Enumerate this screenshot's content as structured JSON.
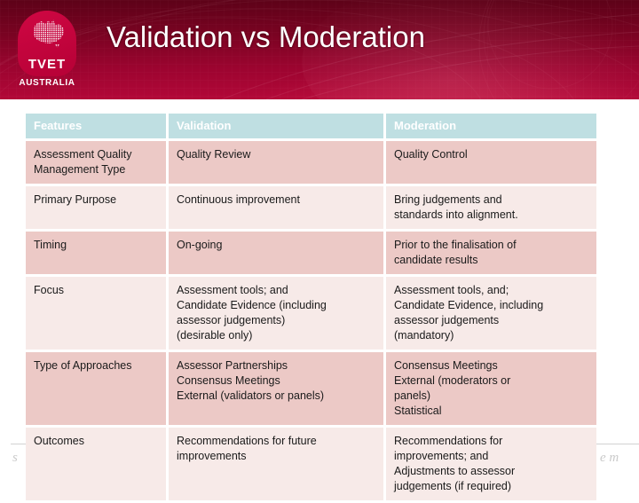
{
  "header": {
    "title": "Validation vs Moderation",
    "logo": {
      "mark_text": "TVET",
      "country_text": "AUSTRALIA"
    }
  },
  "watermarks": {
    "left": "s",
    "right": "e  m"
  },
  "table": {
    "columns": [
      "Features",
      "Validation",
      "Moderation"
    ],
    "rows": [
      {
        "feature": [
          "Assessment Quality",
          "Management Type"
        ],
        "validation": [
          "Quality Review"
        ],
        "moderation": [
          "Quality Control"
        ]
      },
      {
        "feature": [
          "Primary Purpose"
        ],
        "validation": [
          "Continuous improvement"
        ],
        "moderation": [
          "Bring judgements and",
          "standards into alignment."
        ]
      },
      {
        "feature": [
          "Timing"
        ],
        "validation": [
          "On-going"
        ],
        "moderation": [
          "Prior to the finalisation of",
          "candidate results"
        ]
      },
      {
        "feature": [
          "Focus"
        ],
        "validation": [
          "Assessment tools; and",
          "Candidate Evidence (including",
          "assessor judgements)",
          "(desirable only)"
        ],
        "moderation": [
          "Assessment tools, and;",
          "Candidate Evidence, including",
          "assessor judgements",
          "(mandatory)"
        ]
      },
      {
        "feature": [
          "Type of Approaches"
        ],
        "validation": [
          "Assessor Partnerships",
          "Consensus Meetings",
          "External (validators or panels)"
        ],
        "moderation": [
          "Consensus Meetings",
          "External (moderators or",
          "panels)",
          "Statistical"
        ]
      },
      {
        "feature": [
          "Outcomes"
        ],
        "validation": [
          "Recommendations for future",
          "improvements"
        ],
        "moderation": [
          "Recommendations for",
          "improvements; and",
          "Adjustments to assessor",
          "judgements (if required)"
        ]
      }
    ]
  },
  "colors": {
    "banner_dark": "#5d0218",
    "banner_light": "#b20838",
    "logo_badge": "#c8003c",
    "header_row": "#bfdfe2",
    "row_dark": "#ecc9c6",
    "row_light": "#f7eae8"
  }
}
